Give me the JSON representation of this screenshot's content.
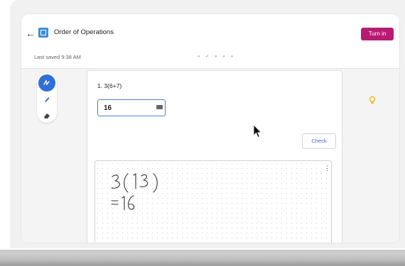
{
  "header": {
    "title": "Order of Operations",
    "turn_in_label": "Turn in",
    "back_icon": "arrow-left-icon",
    "app_icon": "assignment-icon"
  },
  "status": {
    "last_saved": "Last saved 9:38 AM"
  },
  "toolbar": {
    "tools": [
      "handwriting-mode-icon",
      "pen-icon",
      "eraser-icon"
    ]
  },
  "question": {
    "text": "1.  3(6+7)",
    "answer_value": "16",
    "check_label": "Check"
  },
  "workspace": {
    "handwriting_line1": "3(13)",
    "handwriting_line2": "=16"
  },
  "colors": {
    "accent": "#b71b73",
    "tool_active": "#2f6fd8",
    "hint": "#f0b400"
  }
}
